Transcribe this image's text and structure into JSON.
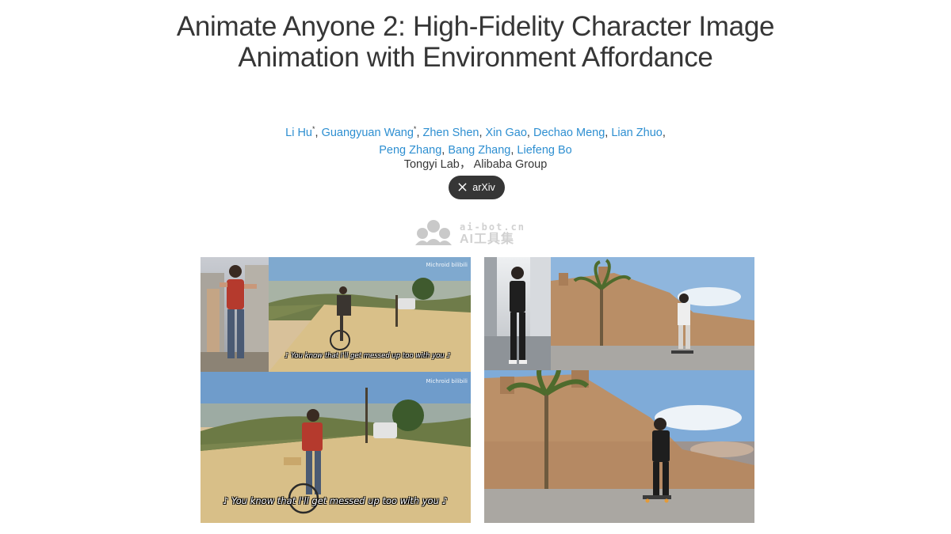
{
  "title": "Animate Anyone 2: High-Fidelity Character Image Animation with Environment Affordance",
  "authors": [
    {
      "name": "Li Hu",
      "mark": "*"
    },
    {
      "name": "Guangyuan Wang",
      "mark": "*"
    },
    {
      "name": "Zhen Shen",
      "mark": ""
    },
    {
      "name": "Xin Gao",
      "mark": ""
    },
    {
      "name": "Dechao Meng",
      "mark": ""
    },
    {
      "name": "Lian Zhuo",
      "mark": ""
    },
    {
      "name": "Peng Zhang",
      "mark": ""
    },
    {
      "name": "Bang Zhang",
      "mark": ""
    },
    {
      "name": "Liefeng Bo",
      "mark": ""
    }
  ],
  "affiliation": "Tongyi Lab， Alibaba Group",
  "arxiv_button": {
    "label": "arXiv",
    "icon": "x-logo-icon"
  },
  "watermark": {
    "url": "ai-bot.cn",
    "name": "AI工具集",
    "icon": "cloud-people-icon"
  },
  "videos": {
    "left": {
      "subtitle_small": "♪ You know that I'll get messed up too with you ♪",
      "subtitle_large": "♪ You know that I'll get messed up too with you ♪",
      "channel_top": "Michroid  bilibili",
      "channel_bottom": "Michroid  bilibili"
    },
    "right": {}
  },
  "colors": {
    "link": "#2e8fd1",
    "text": "#363636",
    "button_bg": "#363636"
  }
}
